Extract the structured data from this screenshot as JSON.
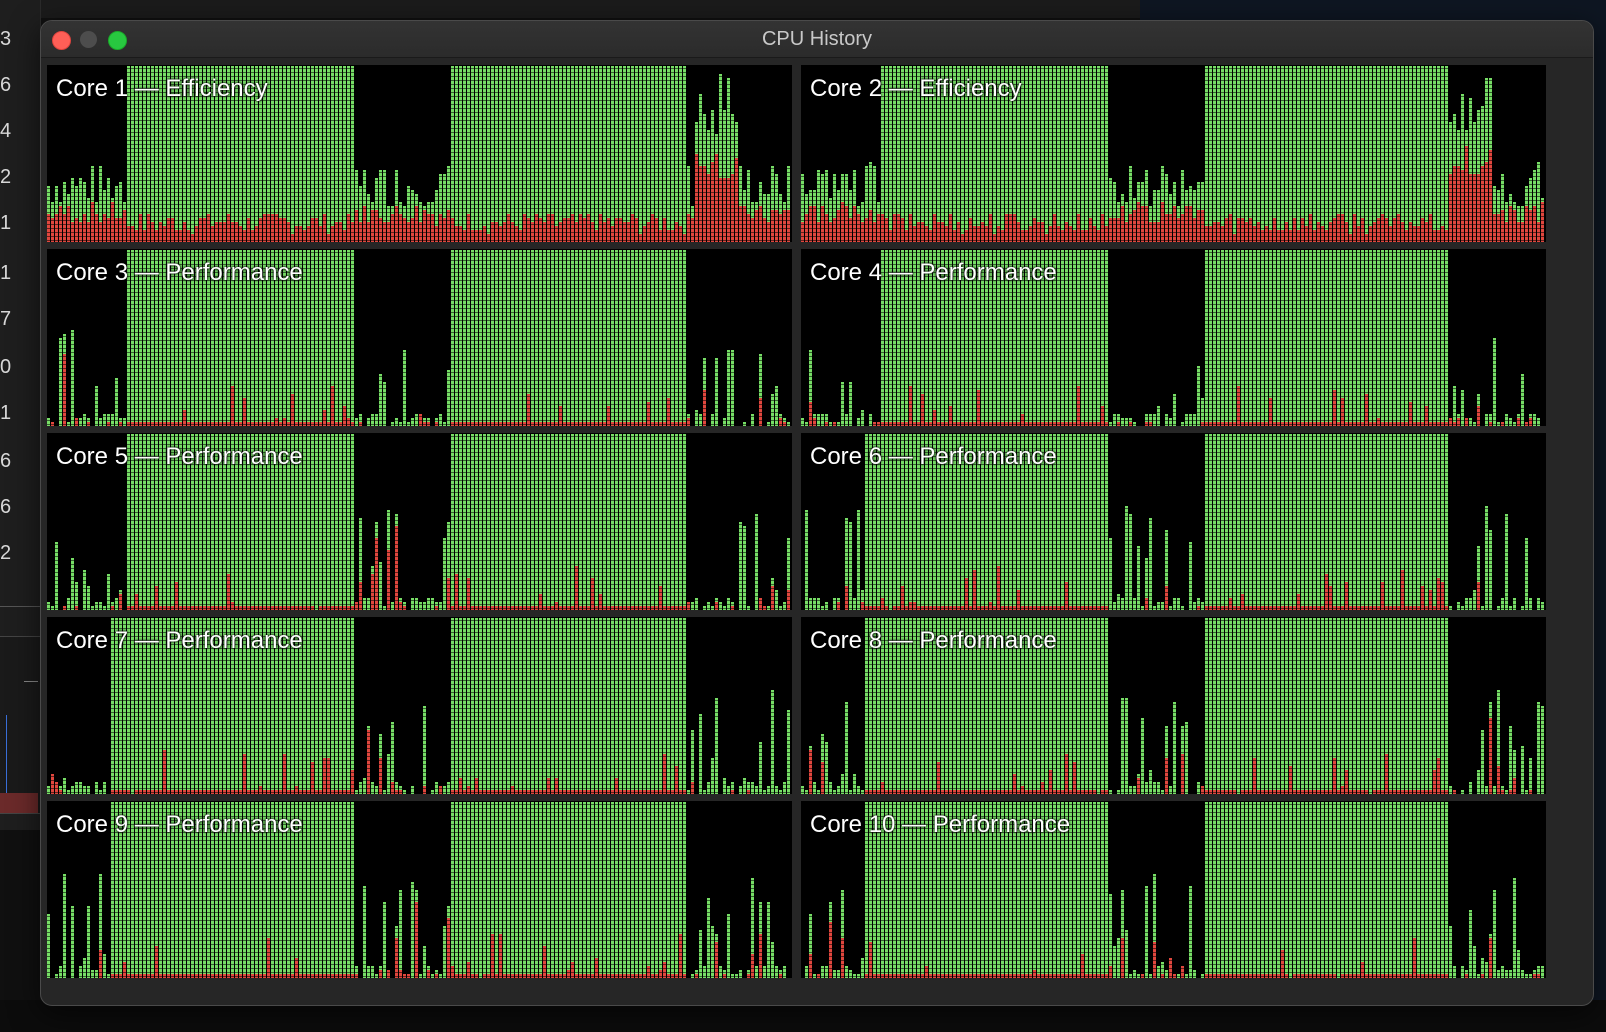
{
  "window": {
    "title": "CPU History"
  },
  "background": {
    "left_numbers": [
      "3",
      "6",
      "4",
      "2",
      "1",
      "1",
      "7",
      "0",
      "1",
      "6",
      "6",
      "2"
    ]
  },
  "colors": {
    "user": "#77dd66",
    "system": "#e0473e",
    "idle": "#000000",
    "grid_line": "#0a2a0a"
  },
  "legend_note": "green = user load, red = system load (fraction of column height, 0-1)",
  "cores": [
    {
      "label": "Core 1 — Efficiency"
    },
    {
      "label": "Core 2 — Efficiency"
    },
    {
      "label": "Core 3 — Performance"
    },
    {
      "label": "Core 4 — Performance"
    },
    {
      "label": "Core 5 — Performance"
    },
    {
      "label": "Core 6 — Performance"
    },
    {
      "label": "Core 7 — Performance"
    },
    {
      "label": "Core 8 — Performance"
    },
    {
      "label": "Core 9 — Performance"
    },
    {
      "label": "Core 10 — Performance"
    }
  ]
}
